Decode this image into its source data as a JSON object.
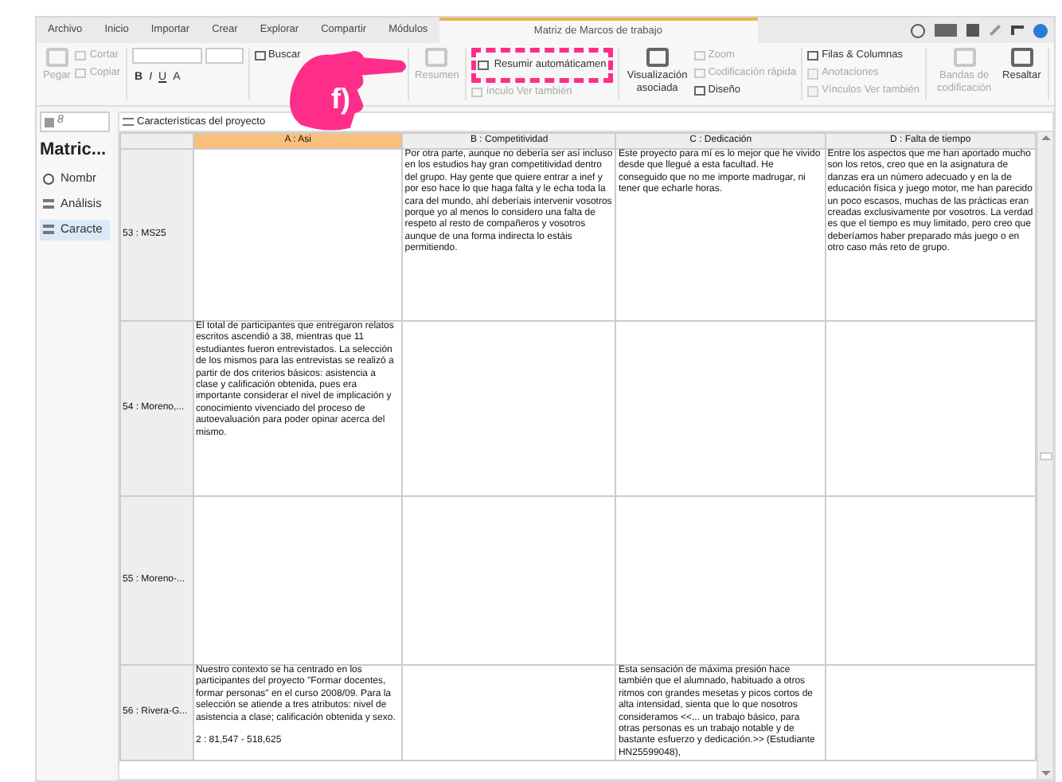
{
  "menu_tabs": [
    {
      "label": "Archivo",
      "selected": false
    },
    {
      "label": "Inicio",
      "selected": false
    },
    {
      "label": "Importar",
      "selected": false
    },
    {
      "label": "Crear",
      "selected": false
    },
    {
      "label": "Explorar",
      "selected": false
    },
    {
      "label": "Compartir",
      "selected": false
    },
    {
      "label": "Módulos",
      "selected": false
    },
    {
      "label": "Matriz de Marcos de trabajo",
      "selected": true
    }
  ],
  "ribbon_groups": [
    {
      "items": [
        {
          "kind": "large",
          "label": "Pegar",
          "disabled": true
        },
        {
          "kind": "small",
          "label": "Cortar",
          "disabled": true
        },
        {
          "kind": "small",
          "label": "Copiar",
          "disabled": true
        }
      ]
    },
    {
      "items": [
        {
          "kind": "format",
          "label": "B",
          "disabled": false
        },
        {
          "kind": "format",
          "label": "I",
          "disabled": false
        },
        {
          "kind": "format",
          "label": "U",
          "disabled": false
        },
        {
          "kind": "format",
          "label": "A",
          "disabled": false
        }
      ]
    },
    {
      "items": [
        {
          "kind": "small",
          "label": "Buscar",
          "disabled": false
        }
      ]
    },
    {
      "items": [
        {
          "kind": "large",
          "label": "Resumen",
          "disabled": true
        }
      ]
    },
    {
      "items": [
        {
          "kind": "highlighted",
          "label": "Resumir automáticamen",
          "disabled": false
        },
        {
          "kind": "small",
          "label": "ínculo Ver también",
          "disabled": true
        }
      ]
    },
    {
      "items": [
        {
          "kind": "large",
          "label": "Visualización asociada",
          "disabled": false
        },
        {
          "kind": "small",
          "label": "Zoom",
          "disabled": true
        },
        {
          "kind": "small",
          "label": "Codificación rápida",
          "disabled": true
        },
        {
          "kind": "small",
          "label": "Diseño",
          "disabled": false
        }
      ]
    },
    {
      "items": [
        {
          "kind": "small",
          "label": "Filas & Columnas",
          "disabled": false
        },
        {
          "kind": "checkbox",
          "label": "Anotaciones",
          "disabled": true
        },
        {
          "kind": "checkbox",
          "label": "Vínculos Ver también",
          "disabled": true
        }
      ]
    },
    {
      "items": [
        {
          "kind": "large",
          "label": "Bandas de codificación",
          "disabled": true
        },
        {
          "kind": "large",
          "label": "Resaltar",
          "disabled": false
        }
      ]
    }
  ],
  "sidebar": {
    "dropdown": "8",
    "title": "Matric...",
    "items": [
      {
        "label": "Nombr",
        "selected": false
      },
      {
        "label": "Análisis",
        "selected": false
      },
      {
        "label": "Caracte",
        "selected": true
      }
    ]
  },
  "grid": {
    "title": "Características del proyecto",
    "columns": [
      {
        "label": "A : Asi",
        "selected": true
      },
      {
        "label": "B : Competitividad",
        "selected": false
      },
      {
        "label": "C : Dedicación",
        "selected": false
      },
      {
        "label": "D : Falta de tiempo",
        "selected": false
      }
    ],
    "rows": [
      {
        "header": "53 : MS25",
        "cells": [
          "",
          "Por otra parte, aunque no debería ser así incluso en los estudios hay gran competitividad dentro del grupo. Hay gente que quiere entrar a inef y por eso hace lo que haga falta y le echa toda la cara del mundo, ahí deberíais intervenir vosotros porque yo al menos lo considero una falta de respeto al resto de compañeros y vosotros aunque de una forma indirecta lo estáis permitiendo.",
          "Este proyecto para mí es lo mejor que he vivido desde que llegué a esta facultad. He conseguido que no me importe madrugar, ni tener que echarle horas.",
          "Entre los aspectos que me han aportado mucho son los retos, creo que en la asignatura de danzas era un número adecuado y en la de educación física y juego motor, me han parecido un poco escasos, muchas de las prácticas eran creadas exclusivamente por vosotros. La verdad es que el tiempo es muy limitado, pero creo que deberíamos haber preparado más juego o en otro caso más reto de grupo."
        ]
      },
      {
        "header": "54 : Moreno,...",
        "cells": [
          "El total de participantes que entregaron relatos escritos ascendió a 38, mientras que 11 estudiantes fueron entrevistados. La selección de los mismos para las entrevistas se realizó a partir de dos criterios básicos: asistencia a clase y calificación obtenida, pues era importante considerar el nivel de implicación y conocimiento vivenciado del proceso de autoevaluación para poder opinar acerca del mismo.",
          "",
          "",
          ""
        ]
      },
      {
        "header": "55 : Moreno-...",
        "cells": [
          "",
          "",
          "",
          ""
        ]
      },
      {
        "header": "56 : Rivera-G...",
        "cells": [
          "Nuestro contexto se ha centrado en los participantes del proyecto \"Formar docentes, formar personas\" en el curso 2008/09. Para la selección se atiende a tres atributos: nivel de asistencia a clase; calificación obtenida y sexo.\n\n2 : 81,547 - 518,625",
          "",
          "Esta sensación de máxima presión hace también que el alumnado, habituado a otros ritmos con grandes mesetas y picos cortos de alta intensidad, sienta que lo que nosotros consideramos <<... un trabajo básico, para otras personas es un trabajo notable y de bastante esfuerzo y dedicación.>> (Estudiante HN25599048),",
          ""
        ]
      }
    ]
  },
  "annotation": {
    "label": "f)"
  }
}
